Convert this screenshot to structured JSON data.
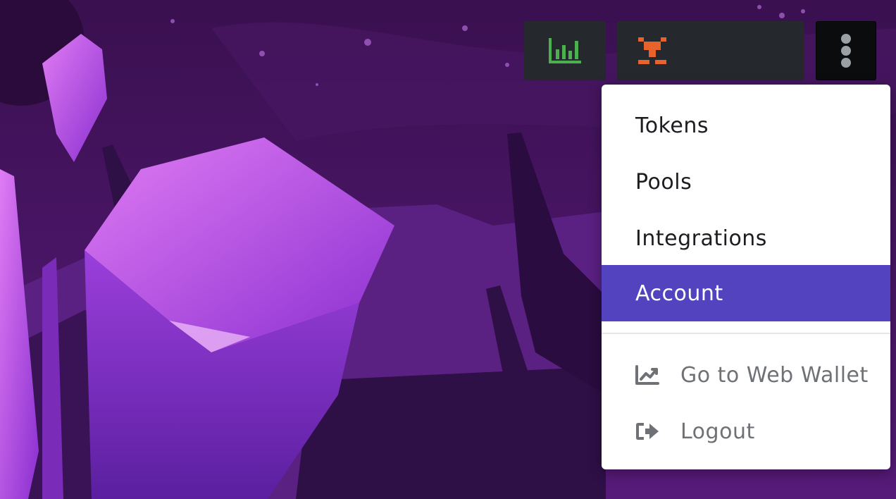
{
  "background": {
    "sky_color": "#3c1452",
    "crystal_color": "#b548e0",
    "mountain_color": "#4b1a68"
  },
  "toolbar": {
    "stats_icon": "bar-chart-icon",
    "stats_icon_color": "#4caf50",
    "bridge_icon": "bridge-node-icon",
    "bridge_icon_color": "#e8622b",
    "menu_icon": "vertical-dots-icon",
    "menu_icon_color": "#9aa0a6"
  },
  "menu": {
    "items": [
      {
        "label": "Tokens"
      },
      {
        "label": "Pools"
      },
      {
        "label": "Integrations"
      },
      {
        "label": "Account",
        "active": true
      }
    ],
    "secondary": [
      {
        "label": "Go to Web Wallet",
        "icon": "line-chart-icon"
      },
      {
        "label": "Logout",
        "icon": "logout-icon"
      }
    ],
    "active_color": "#5343be"
  }
}
